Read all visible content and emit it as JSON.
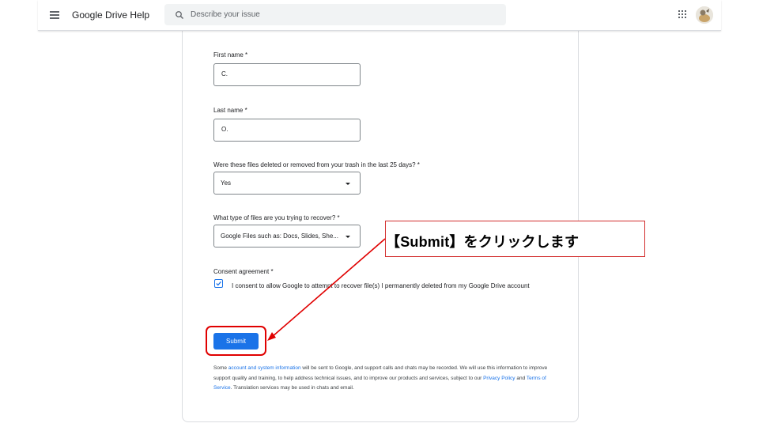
{
  "header": {
    "app_title": "Google Drive Help",
    "search_placeholder": "Describe your issue"
  },
  "form": {
    "first_name": {
      "label": "First name *",
      "value": "C."
    },
    "last_name": {
      "label": "Last name *",
      "value": "O."
    },
    "deleted_question": {
      "label": "Were these files deleted or removed from your trash in the last 25 days? *",
      "value": "Yes"
    },
    "file_type": {
      "label": "What type of files are you trying to recover? *",
      "value": "Google Files such as: Docs, Slides, She..."
    },
    "consent": {
      "label": "Consent agreement *",
      "text": "I consent to allow Google to attempt to recover file(s) I permanently deleted from my Google Drive account",
      "checked": true
    },
    "submit_label": "Submit"
  },
  "footer": {
    "part1": "Some ",
    "link_account": "account and system information",
    "part2": " will be sent to Google, and support calls and chats may be recorded. We will use this information to improve support quality and training, to help address technical issues, and to improve our products and services, subject to our ",
    "link_privacy": "Privacy Policy",
    "part3": " and ",
    "link_terms": "Terms of Service",
    "part4": ". Translation services may be used in chats and email."
  },
  "annotation": {
    "callout_text": "【Submit】をクリックします",
    "color": "#e00000"
  },
  "colors": {
    "primary": "#1a73e8",
    "annotation_red": "#e00000"
  }
}
